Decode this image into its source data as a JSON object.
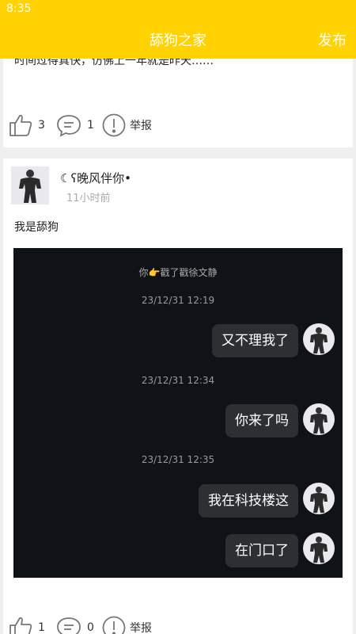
{
  "status": {
    "time": "8:35"
  },
  "app": {
    "title": "舔狗之家",
    "publish": "发布"
  },
  "post1": {
    "partial_text": "时间过得真快，仿佛上一年就是昨天……",
    "likes": "3",
    "comments": "1",
    "report": "举报"
  },
  "post2": {
    "username": "☾ʕ晚风伴你•",
    "time": "11小时前",
    "text": "我是舔狗",
    "chat": {
      "header": "你👉戳了戳徐文静",
      "messages": [
        {
          "time": "23/12/31 12:19",
          "text": "又不理我了"
        },
        {
          "time": "23/12/31 12:34",
          "text": "你来了吗"
        },
        {
          "time": "23/12/31 12:35",
          "text": "我在科技楼这"
        },
        {
          "time": "",
          "text": "在门口了"
        }
      ]
    },
    "likes": "1",
    "comments": "0",
    "report": "举报"
  }
}
